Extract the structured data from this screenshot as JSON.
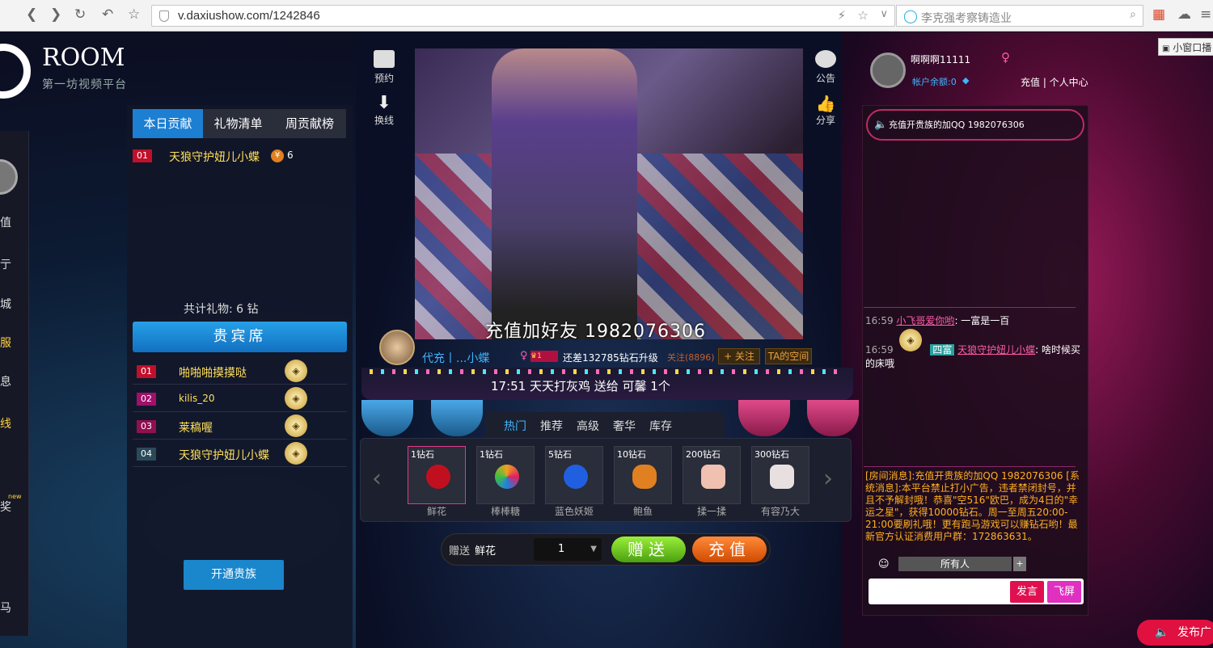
{
  "browser": {
    "url": "v.daxiushow.com/1242846",
    "search_text": "李克强考察铸造业"
  },
  "logo": {
    "room": "ROOM",
    "subtitle": "第一坊视频平台"
  },
  "leftnav": {
    "items": [
      "值",
      "亍",
      "城",
      "服",
      "息",
      "线",
      "奖",
      "new",
      "马"
    ]
  },
  "contrib": {
    "tabs": [
      "本日贡献",
      "礼物清单",
      "周贡献榜"
    ],
    "top": {
      "rank": "01",
      "name": "天狼守护妞儿小蝶",
      "count": "6"
    },
    "total": "共计礼物: 6 钻",
    "vip_title": "贵宾席",
    "vip_rows": [
      {
        "rank": "01",
        "name": "啪啪啪摸摸哒"
      },
      {
        "rank": "02",
        "name": "kilis_20"
      },
      {
        "rank": "03",
        "name": "莱稿喔"
      },
      {
        "rank": "04",
        "name": "天狼守护妞儿小蝶"
      }
    ],
    "open_vip": "开通贵族"
  },
  "stage": {
    "btn_reserve": "预约",
    "btn_switch": "换线",
    "btn_notice": "公告",
    "btn_share": "分享",
    "overlay": "充值加好友 1982076306",
    "host_name": "代充丨...小蝶",
    "upgrade": "还差132785钻石升级",
    "follow_count": "关注(8896)",
    "follow_btn": "+ 关注",
    "ta_space": "TA的空间",
    "ticker": "17:51  天天打灰鸡 送给 可馨    1个"
  },
  "gifts": {
    "tabs": [
      "热门",
      "推荐",
      "高级",
      "奢华",
      "库存"
    ],
    "items": [
      {
        "price": "1钻石",
        "name": "鲜花",
        "color": "#c01020"
      },
      {
        "price": "1钻石",
        "name": "棒棒糖",
        "color": "#f0a020"
      },
      {
        "price": "5钻石",
        "name": "蓝色妖姬",
        "color": "#2060e0"
      },
      {
        "price": "10钻石",
        "name": "鲍鱼",
        "color": "#e08020"
      },
      {
        "price": "200钻石",
        "name": "揉一揉",
        "color": "#f0c0b0"
      },
      {
        "price": "300钻石",
        "name": "有容乃大",
        "color": "#e8e0e0"
      }
    ],
    "send_label": "赠送",
    "send_gift": "鲜花",
    "qty": "1",
    "give_btn": "赠送",
    "recharge_btn": "充值"
  },
  "user": {
    "name": "啊啊啊11111",
    "balance": "帐户余额:0",
    "links": "充值 | 个人中心"
  },
  "chat": {
    "notice": "充值开贵族的加QQ 1982076306",
    "lines": [
      {
        "time": "16:59",
        "user": "小飞哥爱你哟",
        "text": ": 一富是一百"
      },
      {
        "time": "16:59",
        "badge": "四富",
        "user": "天狼守护妞儿小蝶",
        "text": ": 啥时候买的床哦"
      }
    ],
    "system": "[房间消息]:充值开贵族的加QQ 1982076306 [系统消息]:本平台禁止打小广告，违者禁闭封号，并且不予解封哦！恭喜\"空516\"欧巴，成为4日的\"幸运之星\"，获得10000钻石。周一至周五20:00-21:00要刷礼哦！更有跑马游戏可以赚钻石哟！最新官方认证消费用户群：172863631。",
    "target": "所有人",
    "speak_btn": "发言",
    "fly_btn": "飞屏"
  },
  "misc": {
    "small_window": "小窗口播",
    "publish": "发布广"
  }
}
